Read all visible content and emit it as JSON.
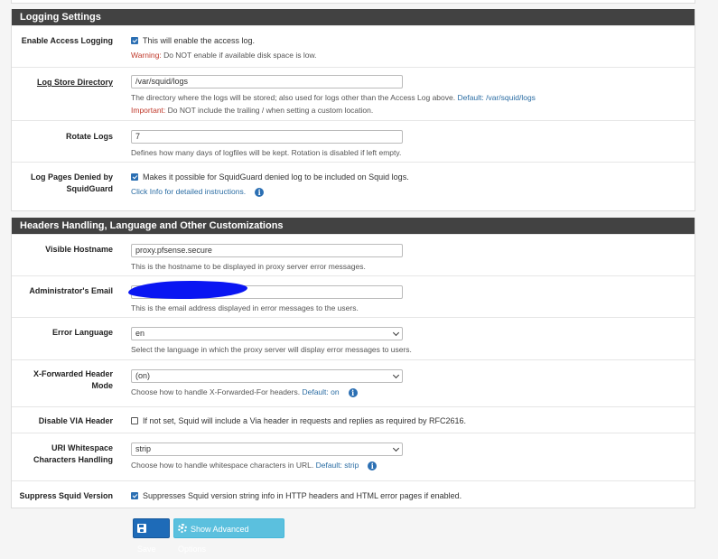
{
  "logging": {
    "title": "Logging Settings",
    "access_logging": {
      "label": "Enable Access Logging",
      "checked": true,
      "text": "This will enable the access log.",
      "warning_label": "Warning:",
      "warning_text": " Do NOT enable if available disk space is low."
    },
    "log_dir": {
      "label": "Log Store Directory",
      "value": "/var/squid/logs",
      "help_main": "The directory where the logs will be stored; also used for logs other than the Access Log above. ",
      "help_default_link": "Default: /var/squid/logs",
      "important_label": "Important:",
      "important_text": " Do NOT include the trailing / when setting a custom location."
    },
    "rotate": {
      "label": "Rotate Logs",
      "value": "7",
      "help": "Defines how many days of logfiles will be kept. Rotation is disabled if left empty."
    },
    "denied": {
      "label_1": "Log Pages Denied by",
      "label_2": "SquidGuard",
      "checked": true,
      "text": "Makes it possible for SquidGuard denied log to be included on Squid logs.",
      "help": "Click Info for detailed instructions."
    }
  },
  "headers": {
    "title": "Headers Handling, Language and Other Customizations",
    "hostname": {
      "label": "Visible Hostname",
      "value": "proxy.pfsense.secure",
      "help": "This is the hostname to be displayed in proxy server error messages."
    },
    "email": {
      "label": "Administrator's Email",
      "value": "",
      "help": "This is the email address displayed in error messages to the users."
    },
    "language": {
      "label": "Error Language",
      "value": "en",
      "help": "Select the language in which the proxy server will display error messages to users."
    },
    "xff": {
      "label_1": "X-Forwarded Header",
      "label_2": "Mode",
      "value": "(on)",
      "help": "Choose how to handle X-Forwarded-For headers. ",
      "help_default": "Default: on"
    },
    "via": {
      "label": "Disable VIA Header",
      "checked": false,
      "text": "If not set, Squid will include a Via header in requests and replies as required by RFC2616."
    },
    "uri": {
      "label_1": "URI Whitespace",
      "label_2": "Characters Handling",
      "value": "strip",
      "help": "Choose how to handle whitespace characters in URL. ",
      "help_default": "Default: strip"
    },
    "suppress": {
      "label": "Suppress Squid Version",
      "checked": true,
      "text": "Suppresses Squid version string info in HTTP headers and HTML error pages if enabled."
    }
  },
  "buttons": {
    "save": "Save",
    "advanced": "Show Advanced Options"
  },
  "colors": {
    "panel_header": "#424242",
    "primary": "#1e6bb8",
    "info_button": "#5bc0de",
    "warning": "#c0392b",
    "redaction": "#0a16f2"
  }
}
